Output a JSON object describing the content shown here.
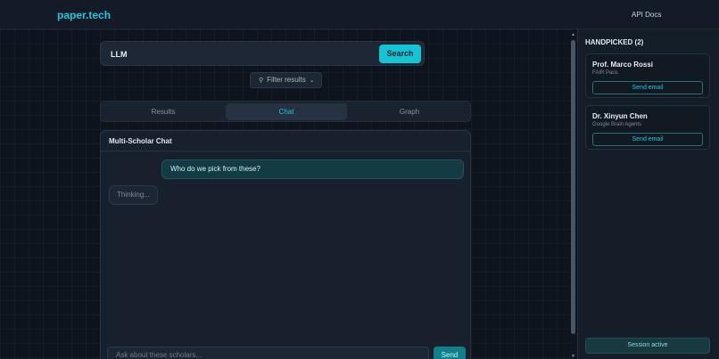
{
  "header": {
    "logo": "paper.tech",
    "api_docs": "API Docs"
  },
  "search": {
    "value": "LLM",
    "button_label": "Search"
  },
  "filter": {
    "label": "Filter results"
  },
  "tabs": [
    {
      "label": "Results",
      "active": false
    },
    {
      "label": "Chat",
      "active": true
    },
    {
      "label": "Graph",
      "active": false
    }
  ],
  "chat": {
    "title": "Multi-Scholar Chat",
    "messages": [
      {
        "role": "user",
        "text": "Who do we pick from these?"
      },
      {
        "role": "assistant",
        "text": "Thinking..."
      }
    ],
    "input_placeholder": "Ask about these scholars...",
    "send_label": "Send"
  },
  "sidebar": {
    "title": "HANDPICKED (2)",
    "scholars": [
      {
        "name": "Prof. Marco Rossi",
        "org": "FAIR Paris",
        "action": "Send email"
      },
      {
        "name": "Dr. Xinyun Chen",
        "org": "Google Brain Agents",
        "action": "Send email"
      }
    ],
    "session_status": "Session active"
  },
  "colors": {
    "accent": "#22c7d8",
    "background": "#0e1520"
  }
}
